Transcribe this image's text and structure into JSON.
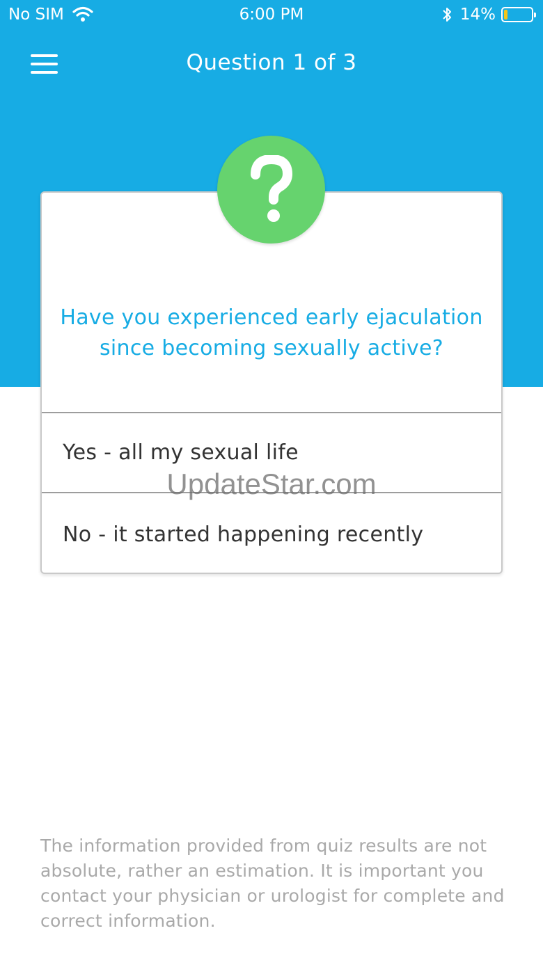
{
  "status_bar": {
    "carrier": "No SIM",
    "time": "6:00 PM",
    "battery_percent": "14%",
    "battery_level": 0.14,
    "battery_color": "#F5C518"
  },
  "nav": {
    "menu_icon": "hamburger-menu-icon",
    "title": "Question 1 of 3"
  },
  "theme": {
    "header_color": "#17ACE4",
    "badge_color": "#66D36E",
    "question_color": "#17ACE4"
  },
  "quiz": {
    "badge_icon": "question-mark-icon",
    "question": "Have you experienced early ejaculation since becoming sexually active?",
    "answers": [
      "Yes - all my sexual life",
      "No - it started happening recently"
    ]
  },
  "watermark": "UpdateStar.com",
  "disclaimer": "The information provided from quiz results are not absolute, rather an estimation. It is important you contact your physician or urologist for complete and correct information."
}
